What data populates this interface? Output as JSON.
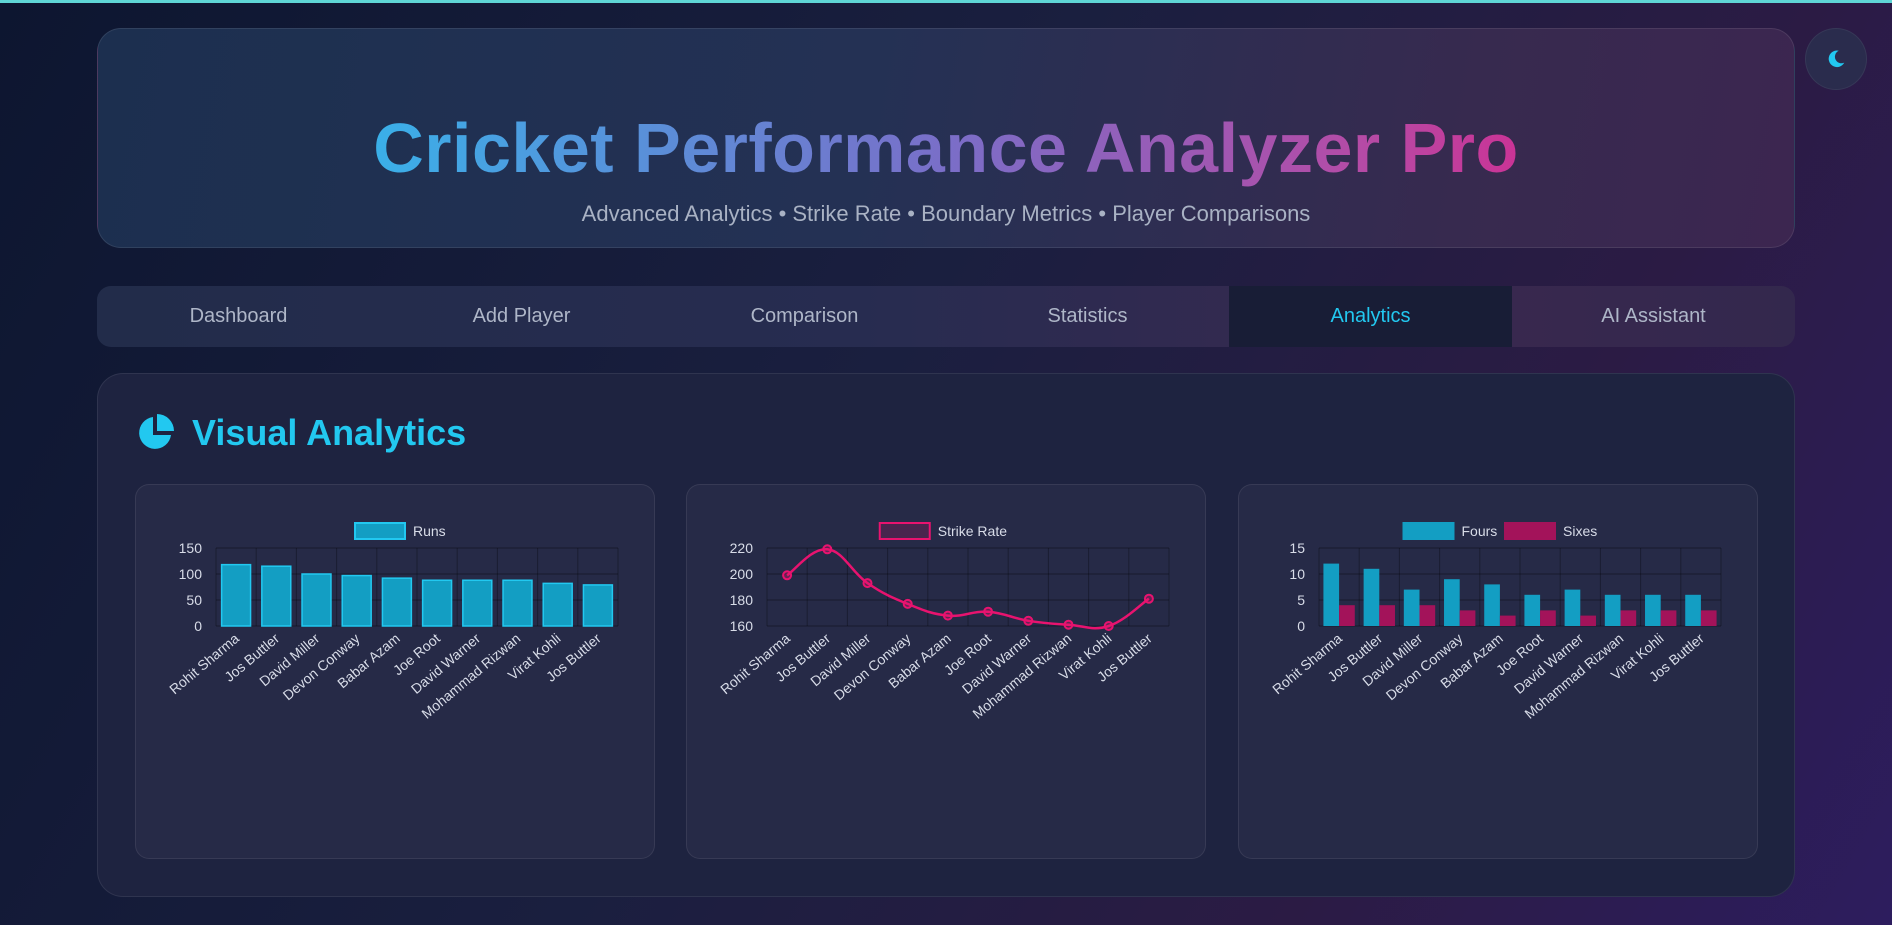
{
  "header": {
    "title": "Cricket Performance Analyzer Pro",
    "subtitle": "Advanced Analytics • Strike Rate • Boundary Metrics • Player Comparisons"
  },
  "theme_toggle": {
    "icon": "moon-icon"
  },
  "tabs": [
    {
      "label": "Dashboard",
      "active": false
    },
    {
      "label": "Add Player",
      "active": false
    },
    {
      "label": "Comparison",
      "active": false
    },
    {
      "label": "Statistics",
      "active": false
    },
    {
      "label": "Analytics",
      "active": true
    },
    {
      "label": "AI Assistant",
      "active": false
    }
  ],
  "panel": {
    "title": "Visual Analytics",
    "icon": "pie-chart-icon"
  },
  "colors": {
    "accent": "#22c8f0",
    "runs_fill": "#139ec3",
    "runs_border": "#22c8f0",
    "strike_line": "#e8136f",
    "sixes_fill": "#a3135a"
  },
  "chart_data": [
    {
      "type": "bar",
      "categories": [
        "Rohit Sharma",
        "Jos Buttler",
        "David Miller",
        "Devon Conway",
        "Babar Azam",
        "Joe Root",
        "David Warner",
        "Mohammad Rizwan",
        "Virat Kohli",
        "Jos Buttler"
      ],
      "series": [
        {
          "name": "Runs",
          "values": [
            118,
            115,
            100,
            97,
            92,
            88,
            88,
            88,
            82,
            79
          ]
        }
      ],
      "ylim": [
        0,
        150
      ],
      "yticks": [
        0,
        50,
        100,
        150
      ],
      "grid": true,
      "legend": "top"
    },
    {
      "type": "line",
      "categories": [
        "Rohit Sharma",
        "Jos Buttler",
        "David Miller",
        "Devon Conway",
        "Babar Azam",
        "Joe Root",
        "David Warner",
        "Mohammad Rizwan",
        "Virat Kohli",
        "Jos Buttler"
      ],
      "series": [
        {
          "name": "Strike Rate",
          "values": [
            199,
            219,
            193,
            177,
            168,
            171,
            164,
            161,
            160,
            181
          ]
        }
      ],
      "ylim": [
        160,
        220
      ],
      "yticks": [
        160,
        180,
        200,
        220
      ],
      "grid": true,
      "legend": "top"
    },
    {
      "type": "bar",
      "categories": [
        "Rohit Sharma",
        "Jos Buttler",
        "David Miller",
        "Devon Conway",
        "Babar Azam",
        "Joe Root",
        "David Warner",
        "Mohammad Rizwan",
        "Virat Kohli",
        "Jos Buttler"
      ],
      "series": [
        {
          "name": "Fours",
          "values": [
            12,
            11,
            7,
            9,
            8,
            6,
            7,
            6,
            6,
            6
          ]
        },
        {
          "name": "Sixes",
          "values": [
            4,
            4,
            4,
            3,
            2,
            3,
            2,
            3,
            3,
            3
          ]
        }
      ],
      "ylim": [
        0,
        15
      ],
      "yticks": [
        0,
        5,
        10,
        15
      ],
      "grid": true,
      "legend": "top"
    }
  ]
}
